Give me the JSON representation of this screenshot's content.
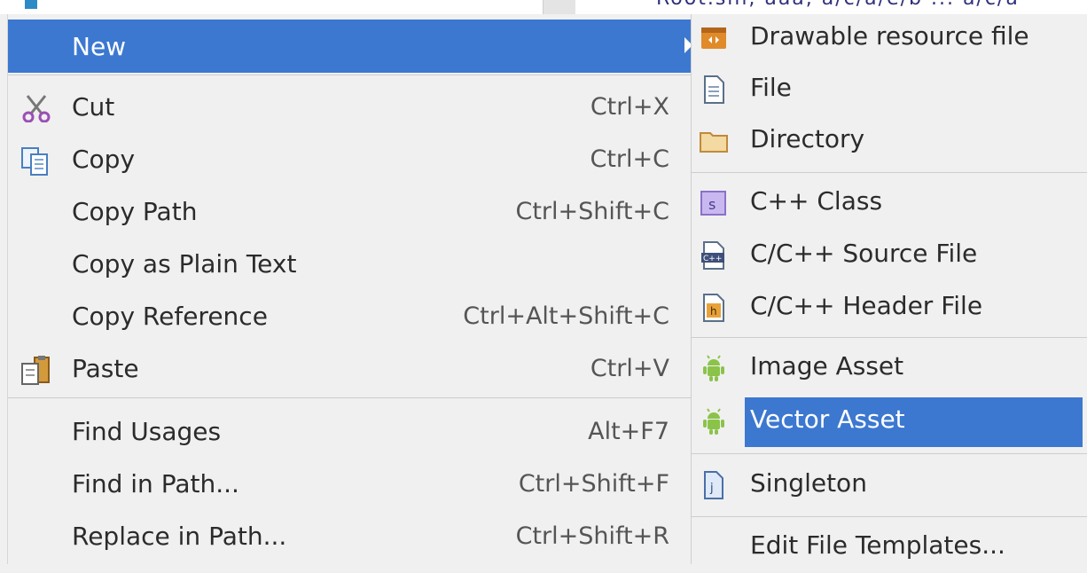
{
  "background": {
    "garbled_text": "Root.sln, aaa, a/c/a/e/b ... a/c/a"
  },
  "menu": {
    "items": [
      {
        "label": "New",
        "shortcut": "",
        "icon": "none",
        "has_submenu": true,
        "selected": true
      },
      {
        "label": "Cut",
        "shortcut": "Ctrl+X",
        "icon": "scissors-icon"
      },
      {
        "label": "Copy",
        "shortcut": "Ctrl+C",
        "icon": "copy-icon"
      },
      {
        "label": "Copy Path",
        "shortcut": "Ctrl+Shift+C",
        "icon": "none"
      },
      {
        "label": "Copy as Plain Text",
        "shortcut": "",
        "icon": "none"
      },
      {
        "label": "Copy Reference",
        "shortcut": "Ctrl+Alt+Shift+C",
        "icon": "none"
      },
      {
        "label": "Paste",
        "shortcut": "Ctrl+V",
        "icon": "paste-icon"
      },
      {
        "label": "Find Usages",
        "shortcut": "Alt+F7",
        "icon": "none"
      },
      {
        "label": "Find in Path...",
        "shortcut": "Ctrl+Shift+F",
        "icon": "none"
      },
      {
        "label": "Replace in Path...",
        "shortcut": "Ctrl+Shift+R",
        "icon": "none"
      }
    ]
  },
  "submenu": {
    "items": [
      {
        "label": "Drawable resource file",
        "icon": "drawable-icon"
      },
      {
        "label": "File",
        "icon": "file-icon"
      },
      {
        "label": "Directory",
        "icon": "folder-icon"
      },
      {
        "label": "C++ Class",
        "icon": "cpp-class-icon"
      },
      {
        "label": "C/C++ Source File",
        "icon": "cpp-source-icon"
      },
      {
        "label": "C/C++ Header File",
        "icon": "cpp-header-icon"
      },
      {
        "label": "Image Asset",
        "icon": "android-icon"
      },
      {
        "label": "Vector Asset",
        "icon": "android-icon",
        "selected": true
      },
      {
        "label": "Singleton",
        "icon": "java-class-icon"
      },
      {
        "label": "Edit File Templates...",
        "icon": "none"
      }
    ]
  },
  "colors": {
    "selection": "#3c78d0",
    "menu_bg": "#f0f0f0",
    "android_green": "#8bc34a"
  }
}
